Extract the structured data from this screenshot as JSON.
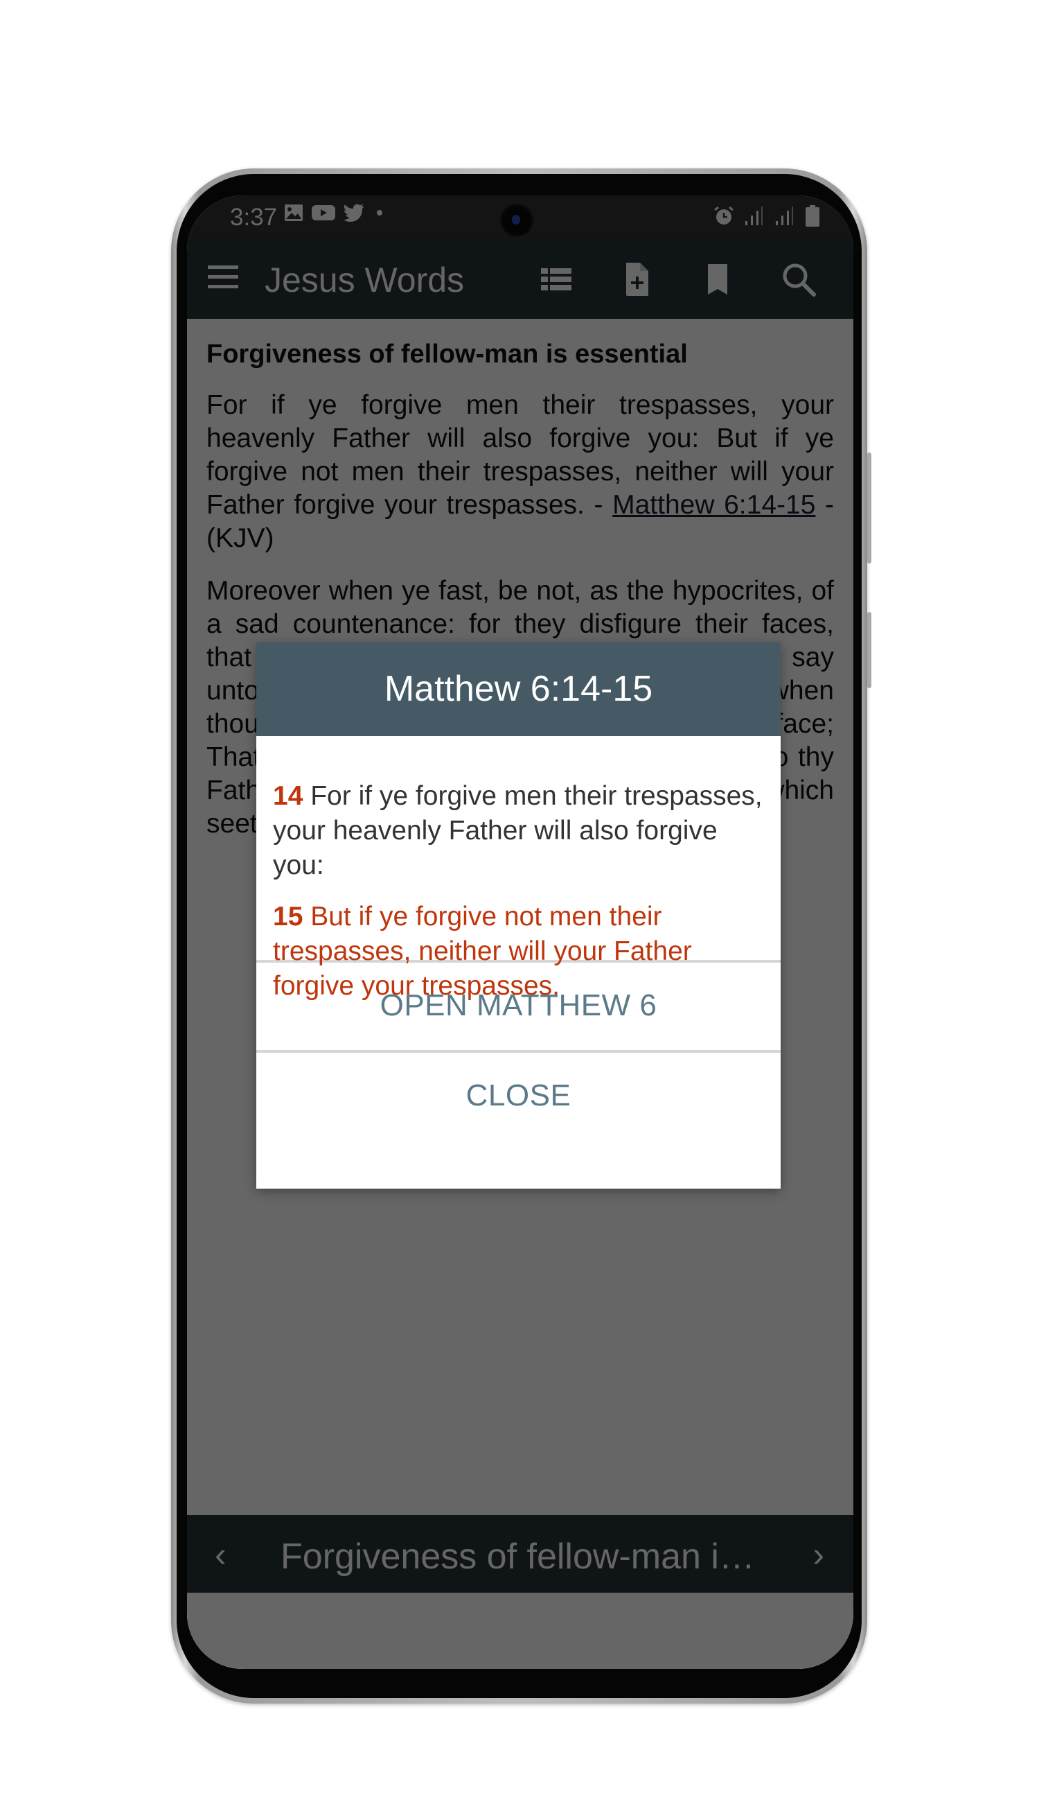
{
  "status_bar": {
    "time": "3:37",
    "left_icons": [
      "gallery-icon",
      "youtube-icon",
      "twitter-icon",
      "dot-icon"
    ],
    "right_icons": [
      "alarm-icon",
      "signal-icon",
      "signal-icon",
      "battery-icon"
    ]
  },
  "app_bar": {
    "title": "Jesus Words",
    "actions": [
      "list-icon",
      "add-note-icon",
      "bookmark-icon",
      "search-icon"
    ]
  },
  "content": {
    "heading": "Forgiveness of fellow-man is essential",
    "paragraph1": {
      "text": "For if ye forgive men their trespasses, your heavenly Father will also forgive you: But if ye forgive not men their trespasses, neither will your Father forgive your trespasses. - ",
      "link": "Matthew 6:14-15",
      "suffix": " - (KJV)"
    },
    "paragraph2": "Moreover when ye fast, be not, as the hypocrites, of a sad countenance: for they disfigure their faces, that they may appear unto men to fast. Verily I say unto you, They have their reward. But thou, when thou fastest, anoint thine head, and wash thy face; That thou appear not unto men to fast, but unto thy Father which is in secret: and thy Father, which seeth in secret, shall reward thee openly."
  },
  "bottom_bar": {
    "prev_label": "‹",
    "title": "Forgiveness of fellow-man is...",
    "next_label": "›"
  },
  "nav_bar": [
    "recents-icon",
    "home-icon",
    "back-icon"
  ],
  "dialog": {
    "title": "Matthew 6:14-15",
    "verses": [
      {
        "number": "14",
        "text": "For if ye forgive men their trespasses, your heavenly Father will also forgive you:"
      },
      {
        "number": "15",
        "text": "But if ye forgive not men their trespasses, neither will your Father forgive your trespasses."
      }
    ],
    "open_button": "OPEN MATTHEW 6",
    "close_button": "CLOSE"
  },
  "colors": {
    "app_bar": "#263238",
    "dialog_header": "#455a64",
    "verse_accent": "#bf360c",
    "button_text": "#5b7a89"
  }
}
